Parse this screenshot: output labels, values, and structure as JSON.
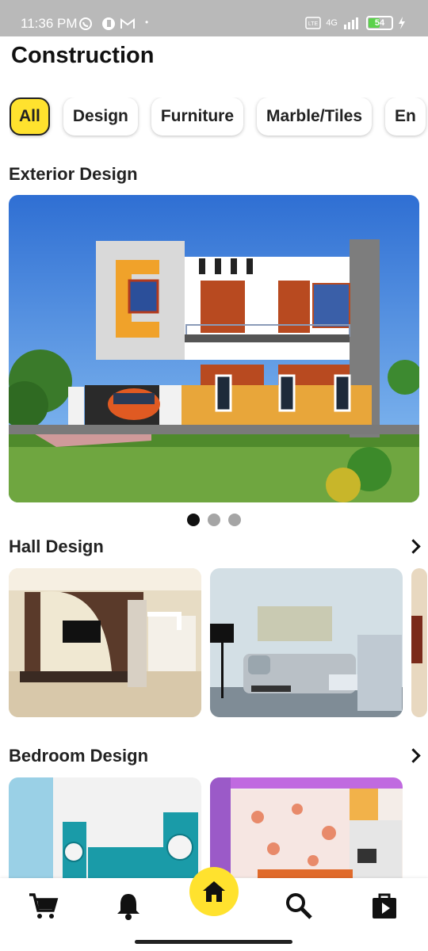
{
  "status": {
    "time": "11:36 PM",
    "network": "4G",
    "battery": "54",
    "battery_level": 0.54
  },
  "app": {
    "title": "Construction"
  },
  "categories": [
    "All",
    "Design",
    "Furniture",
    "Marble/Tiles",
    "En"
  ],
  "active_category": "All",
  "sections": {
    "exterior": {
      "title": "Exterior Design"
    },
    "hall": {
      "title": "Hall Design"
    },
    "bedroom": {
      "title": "Bedroom Design"
    }
  },
  "carousel": {
    "total": 3,
    "active": 1
  },
  "nav": {
    "items": [
      "cart-icon",
      "bell-icon",
      "home-icon",
      "search-icon",
      "store-icon"
    ],
    "active": "home-icon"
  },
  "colors": {
    "accent": "#ffe22e",
    "text": "#222222"
  }
}
